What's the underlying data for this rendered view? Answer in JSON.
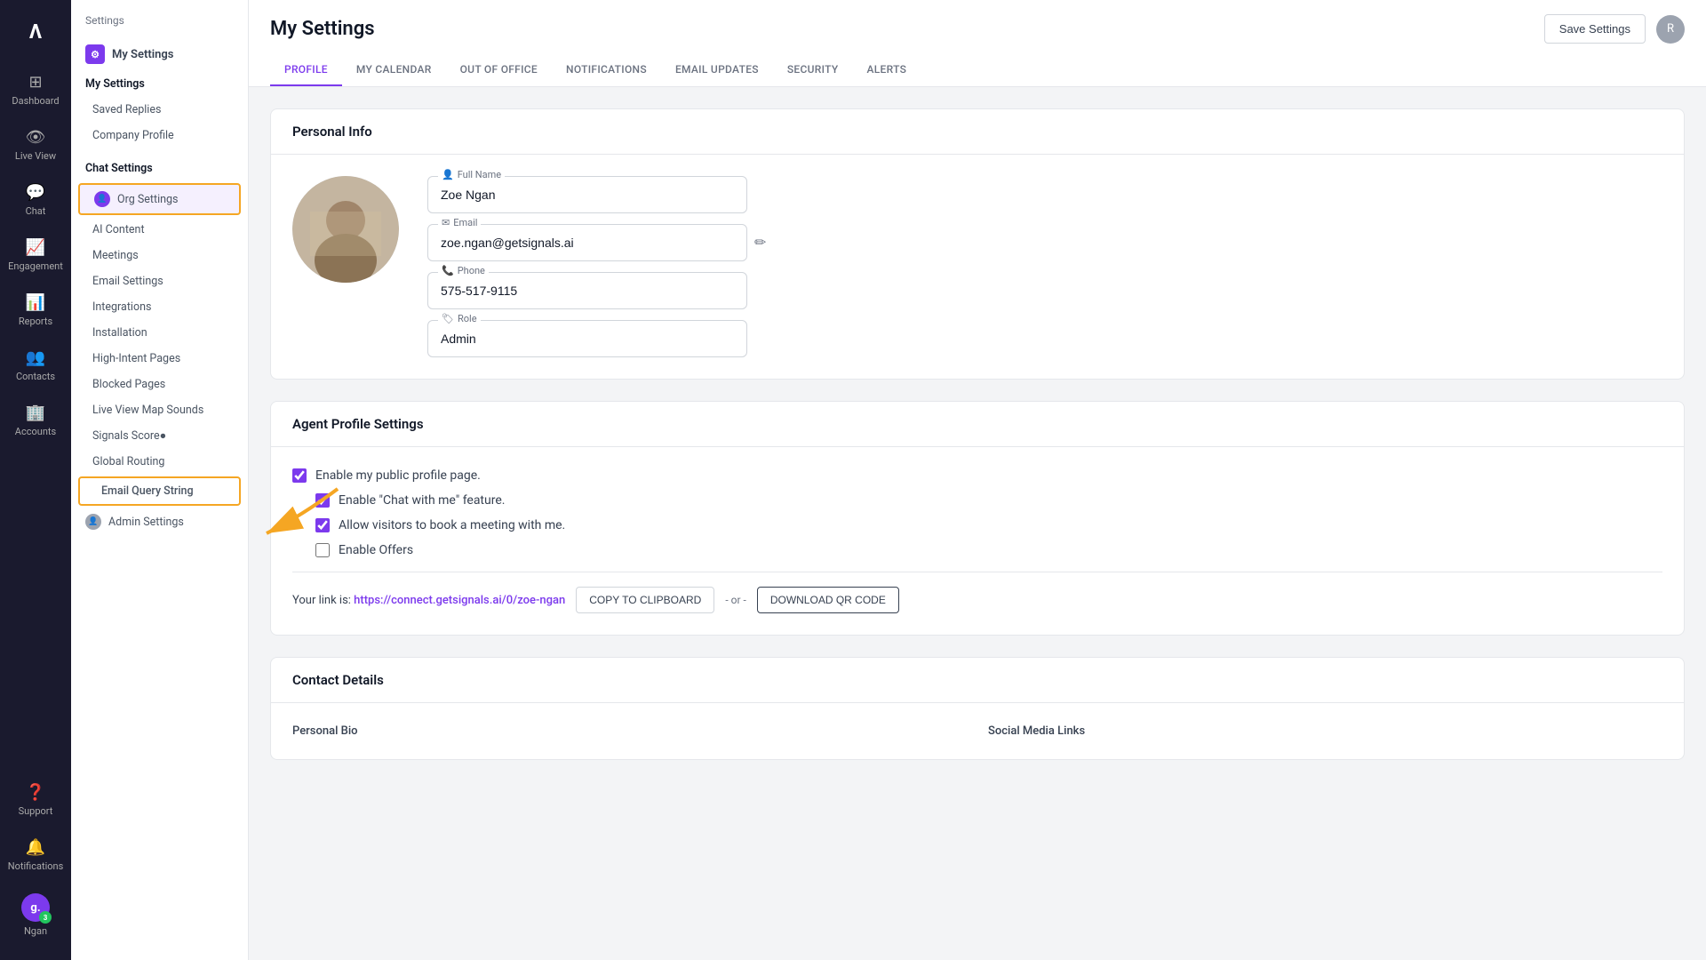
{
  "app": {
    "title": "Dashboard"
  },
  "far_left_nav": {
    "logo": "Λ",
    "items": [
      {
        "id": "dashboard",
        "label": "Dashboard",
        "icon": "⊞"
      },
      {
        "id": "live-view",
        "label": "Live View",
        "icon": "👁"
      },
      {
        "id": "chat",
        "label": "Chat",
        "icon": "💬"
      },
      {
        "id": "engagement",
        "label": "Engagement",
        "icon": "📈"
      },
      {
        "id": "reports",
        "label": "Reports",
        "icon": "📊"
      },
      {
        "id": "contacts",
        "label": "Contacts",
        "icon": "👥"
      },
      {
        "id": "accounts",
        "label": "Accounts",
        "icon": "🏢"
      }
    ],
    "bottom_items": [
      {
        "id": "support",
        "label": "Support",
        "icon": "❓"
      },
      {
        "id": "notifications",
        "label": "Notifications",
        "icon": "🔔"
      }
    ],
    "user": {
      "initials": "g.",
      "badge": "3",
      "name": "Ngan"
    }
  },
  "settings_sidebar": {
    "breadcrumb": "Settings",
    "my_settings_icon": "⚙",
    "my_settings_label": "My Settings",
    "menu_items": [
      {
        "id": "my-settings",
        "label": "My Settings",
        "type": "section-title"
      },
      {
        "id": "saved-replies",
        "label": "Saved Replies",
        "type": "item"
      },
      {
        "id": "company-profile",
        "label": "Company Profile",
        "type": "item"
      },
      {
        "id": "chat-settings",
        "label": "Chat Settings",
        "type": "section-header"
      },
      {
        "id": "org-settings",
        "label": "Org Settings",
        "type": "org-item"
      },
      {
        "id": "ai-content",
        "label": "AI Content",
        "type": "item"
      },
      {
        "id": "meetings",
        "label": "Meetings",
        "type": "item"
      },
      {
        "id": "email-settings",
        "label": "Email Settings",
        "type": "item"
      },
      {
        "id": "integrations",
        "label": "Integrations",
        "type": "item"
      },
      {
        "id": "installation",
        "label": "Installation",
        "type": "item"
      },
      {
        "id": "high-intent-pages",
        "label": "High-Intent Pages",
        "type": "item"
      },
      {
        "id": "blocked-pages",
        "label": "Blocked Pages",
        "type": "item"
      },
      {
        "id": "live-view-map-sounds",
        "label": "Live View Map Sounds",
        "type": "item"
      },
      {
        "id": "signals-score",
        "label": "Signals Score●",
        "type": "item"
      },
      {
        "id": "global-routing",
        "label": "Global Routing",
        "type": "item"
      },
      {
        "id": "email-query-string",
        "label": "Email Query String",
        "type": "email-query"
      },
      {
        "id": "admin-settings",
        "label": "Admin Settings",
        "type": "admin-item"
      }
    ]
  },
  "page": {
    "title": "My Settings",
    "save_button": "Save Settings"
  },
  "tabs": [
    {
      "id": "profile",
      "label": "PROFILE",
      "active": true
    },
    {
      "id": "my-calendar",
      "label": "MY CALENDAR",
      "active": false
    },
    {
      "id": "out-of-office",
      "label": "OUT OF OFFICE",
      "active": false
    },
    {
      "id": "notifications",
      "label": "NOTIFICATIONS",
      "active": false
    },
    {
      "id": "email-updates",
      "label": "EMAIL UPDATES",
      "active": false
    },
    {
      "id": "security",
      "label": "SECURITY",
      "active": false
    },
    {
      "id": "alerts",
      "label": "ALERTS",
      "active": false
    }
  ],
  "personal_info": {
    "section_title": "Personal Info",
    "full_name_label": "Full Name",
    "full_name_value": "Zoe Ngan",
    "email_label": "Email",
    "email_value": "zoe.ngan@getsignals.ai",
    "phone_label": "Phone",
    "phone_value": "575-517-9115",
    "role_label": "Role",
    "role_value": "Admin"
  },
  "agent_profile": {
    "section_title": "Agent Profile Settings",
    "checkboxes": [
      {
        "id": "public-profile",
        "label": "Enable my public profile page.",
        "checked": true,
        "indent": 0
      },
      {
        "id": "chat-with-me",
        "label": "Enable \"Chat with me\" feature.",
        "checked": true,
        "indent": 1
      },
      {
        "id": "book-meeting",
        "label": "Allow visitors to book a meeting with me.",
        "checked": true,
        "indent": 1
      },
      {
        "id": "enable-offers",
        "label": "Enable Offers",
        "checked": false,
        "indent": 1
      }
    ],
    "link_prefix": "Your link is: ",
    "link_url": "https://connect.getsignals.ai/0/zoe-ngan",
    "copy_button": "COPY TO CLIPBOARD",
    "or_text": "- or -",
    "qr_button": "DOWNLOAD QR CODE"
  },
  "contact_details": {
    "section_title": "Contact Details",
    "personal_bio_label": "Personal Bio",
    "social_media_label": "Social Media Links"
  }
}
